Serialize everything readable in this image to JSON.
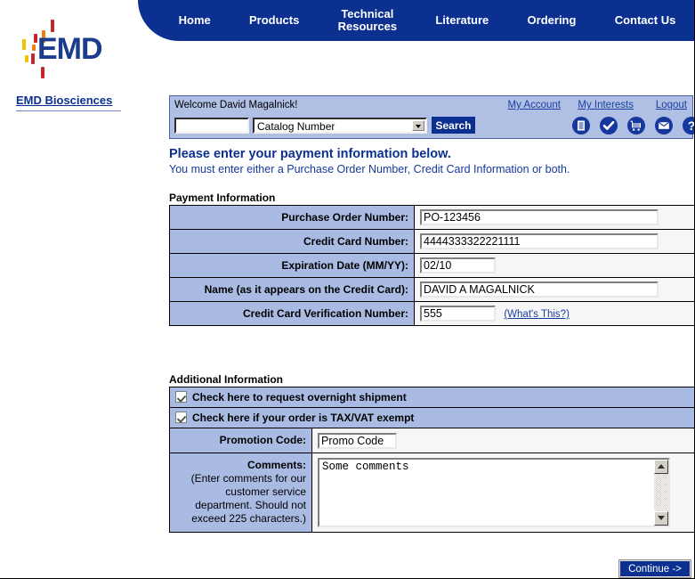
{
  "brand": {
    "logo_text": "EMD",
    "site_link": "EMD Biosciences",
    "accent_blue": "#1b3c8c",
    "accent_red": "#c1272d",
    "accent_orange": "#f07f13",
    "accent_yellow": "#f2c200"
  },
  "nav": {
    "items": [
      {
        "label": "Home"
      },
      {
        "label": "Products"
      },
      {
        "label": "Technical\nResources"
      },
      {
        "label": "Literature"
      },
      {
        "label": "Ordering"
      },
      {
        "label": "Contact Us"
      }
    ],
    "bar_color": "#0b3090"
  },
  "search_panel": {
    "welcome": "Welcome David Magalnick!",
    "links": [
      {
        "name": "my-account",
        "label": "My Account"
      },
      {
        "name": "my-interests",
        "label": "My Interests"
      },
      {
        "name": "logout",
        "label": "Logout"
      }
    ],
    "search_value": "",
    "search_placeholder": "",
    "category_selected": "Catalog Number",
    "category_options": [
      "Catalog Number"
    ],
    "search_button": "Search",
    "icons": [
      {
        "name": "order-list-icon"
      },
      {
        "name": "check-circle-icon"
      },
      {
        "name": "shopping-cart-icon"
      },
      {
        "name": "envelope-icon"
      },
      {
        "name": "help-question-icon"
      }
    ]
  },
  "page": {
    "heading": "Please enter your payment information below.",
    "subheading": "You must enter either a Purchase Order Number, Credit Card Information or both."
  },
  "payment_section": {
    "title": "Payment Information",
    "rows": [
      {
        "label": "Purchase Order Number:",
        "value": "PO-123456",
        "field": "purchase-order-number",
        "size": "wide"
      },
      {
        "label": "Credit Card Number:",
        "value": "4444333322221111",
        "field": "credit-card-number",
        "size": "wide"
      },
      {
        "label": "Expiration Date (MM/YY):",
        "value": "02/10",
        "field": "expiration-date",
        "size": "small"
      },
      {
        "label": "Name (as it appears on the Credit Card):",
        "value": "DAVID A MAGALNICK",
        "field": "cardholder-name",
        "size": "wide"
      },
      {
        "label": "Credit Card Verification Number:",
        "value": "555",
        "field": "cvv-number",
        "size": "small",
        "link": "(What's This?)"
      }
    ]
  },
  "additional_section": {
    "title": "Additional Information",
    "checkboxes": [
      {
        "label": "Check here to request overnight shipment",
        "checked": true,
        "field": "overnight-shipment"
      },
      {
        "label": "Check here if your order is TAX/VAT exempt",
        "checked": true,
        "field": "tax-vat-exempt"
      }
    ],
    "promotion_label": "Promotion Code:",
    "promotion_value": "Promo Code",
    "comments_label": "Comments:",
    "comments_note": "(Enter comments for our customer service department. Should not exceed 225 characters.)",
    "comments_value": "Some comments"
  },
  "footer": {
    "continue_label": "Continue ->"
  }
}
